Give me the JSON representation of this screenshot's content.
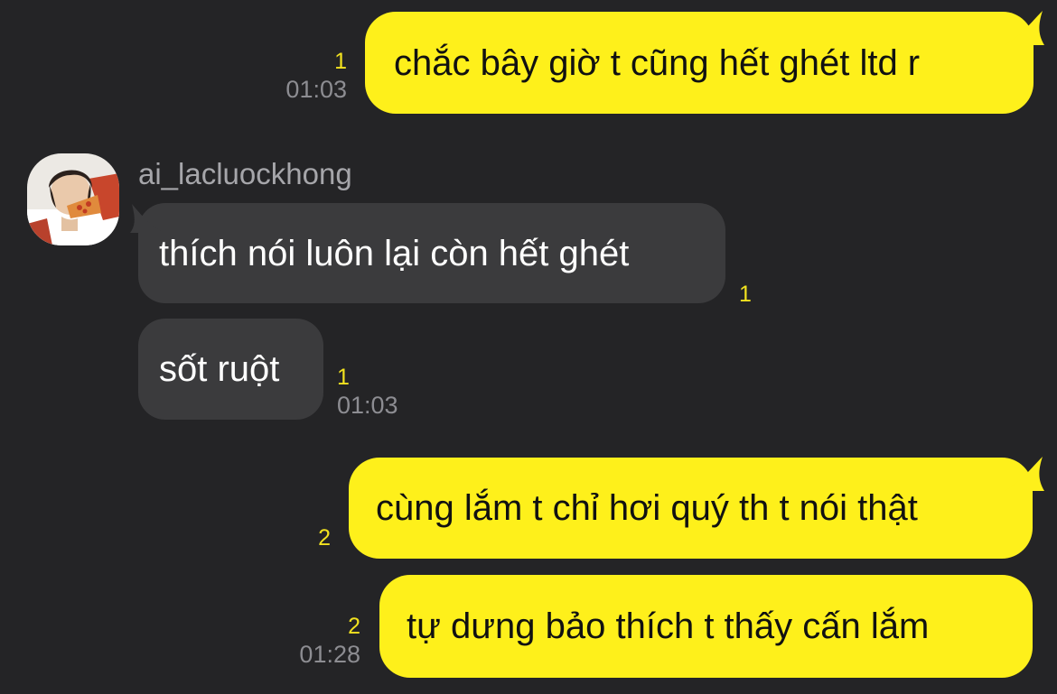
{
  "contact": {
    "name": "ai_lacluockhong",
    "avatar_icon": "profile-photo-icon"
  },
  "colors": {
    "background": "#242426",
    "outgoing_bubble": "#fef01b",
    "incoming_bubble": "#3b3b3d",
    "unread_count": "#f2e21f",
    "timestamp": "#8d8d92"
  },
  "messages": [
    {
      "direction": "outgoing",
      "text": "chắc bây giờ t cũng hết ghét ltd r",
      "unread": "1",
      "time": "01:03"
    },
    {
      "direction": "incoming",
      "text": "thích nói luôn lại còn hết ghét",
      "unread": "1",
      "time": ""
    },
    {
      "direction": "incoming",
      "text": "sốt ruột",
      "unread": "1",
      "time": "01:03"
    },
    {
      "direction": "outgoing",
      "text": "cùng lắm t chỉ hơi quý th t nói thật",
      "unread": "2",
      "time": ""
    },
    {
      "direction": "outgoing",
      "text": "tự dưng bảo thích t thấy cấn lắm",
      "unread": "2",
      "time": "01:28"
    }
  ]
}
